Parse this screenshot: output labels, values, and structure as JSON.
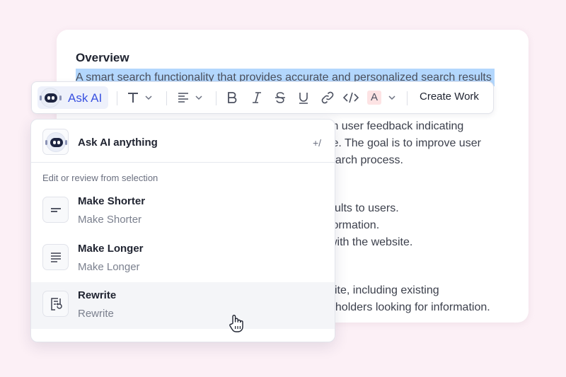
{
  "document": {
    "title": "Overview",
    "selected_text": "A smart search functionality that provides accurate and personalized search results",
    "lines": [
      "m user feedback indicating",
      "te. The goal is to improve user",
      "earch process.",
      "sults to users.",
      "formation.",
      "with the website.",
      "site, including existing",
      "eholders looking for information."
    ]
  },
  "toolbar": {
    "ask_ai_label": "Ask AI",
    "text_style_icon": "text-format-icon",
    "align_icon": "align-left-icon",
    "bold_icon": "bold-icon",
    "italic_icon": "italic-icon",
    "strike_icon": "strikethrough-icon",
    "underline_icon": "underline-icon",
    "link_icon": "link-icon",
    "code_icon": "code-icon",
    "color_icon_letter": "A",
    "create_work_label": "Create Work",
    "accent_color": "#3a52e0"
  },
  "menu": {
    "ask_anything_label": "Ask AI anything",
    "shortcut": "+/",
    "section_label": "Edit or review from selection",
    "items": [
      {
        "title": "Make Shorter",
        "subtitle": "Make Shorter",
        "icon": "short-lines-icon"
      },
      {
        "title": "Make Longer",
        "subtitle": "Make Longer",
        "icon": "long-lines-icon"
      },
      {
        "title": "Rewrite",
        "subtitle": "Rewrite",
        "icon": "rewrite-document-icon"
      }
    ],
    "hovered_item": "Rewrite"
  }
}
